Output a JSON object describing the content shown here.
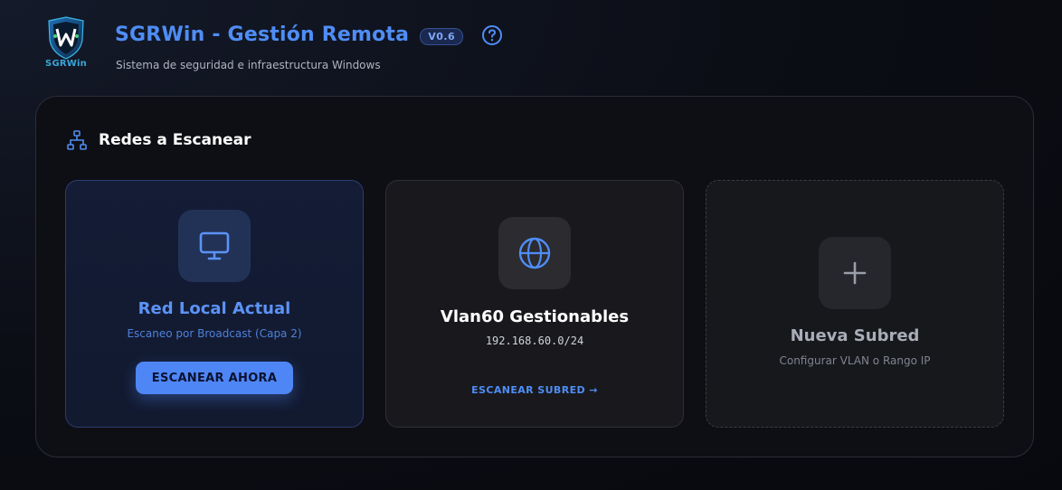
{
  "app": {
    "logo_text": "SGRWin",
    "title": "SGRWin - Gestión Remota",
    "version": "V0.6",
    "subtitle": "Sistema de seguridad e infraestructura Windows"
  },
  "icons": {
    "help": "help-circle-icon",
    "section": "network-topology-icon",
    "local": "monitor-icon",
    "vlan": "globe-icon",
    "new": "plus-icon"
  },
  "section": {
    "title": "Redes a Escanear"
  },
  "cards": {
    "local": {
      "title": "Red Local Actual",
      "subtitle": "Escaneo por Broadcast (Capa 2)",
      "button": "ESCANEAR AHORA"
    },
    "vlan": {
      "title": "Vlan60 Gestionables",
      "cidr": "192.168.60.0/24",
      "link": "ESCANEAR SUBRED →"
    },
    "new": {
      "title": "Nueva Subred",
      "subtitle": "Configurar VLAN o Rango IP"
    }
  },
  "colors": {
    "accent": "#4f86f5",
    "title_blue": "#4f8df5",
    "background": "#0b0d14"
  }
}
